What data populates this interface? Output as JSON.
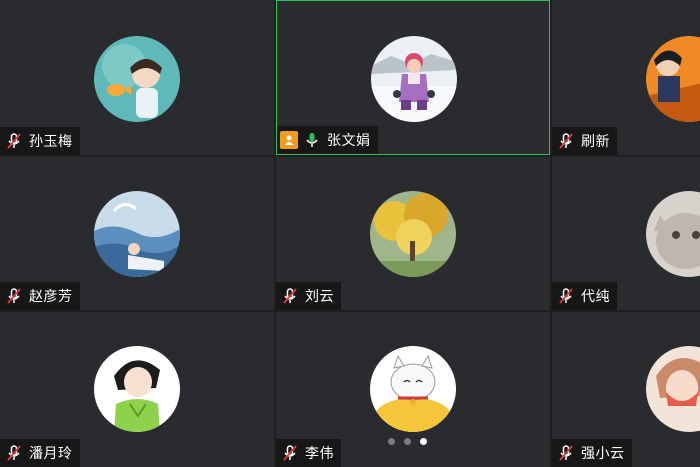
{
  "participants": [
    {
      "name": "孙玉梅",
      "mic": "muted",
      "avatar": "boy-fish-cartoon-avatar"
    },
    {
      "name": "张文娟",
      "mic": "on",
      "host": true,
      "active": true,
      "avatar": "child-snow-photo-avatar"
    },
    {
      "name": "刷新",
      "mic": "muted",
      "avatar": "anime-character-avatar"
    },
    {
      "name": "赵彦芳",
      "mic": "muted",
      "avatar": "sea-girl-illustration-avatar"
    },
    {
      "name": "刘云",
      "mic": "muted",
      "avatar": "ginkgo-tree-avatar"
    },
    {
      "name": "代纯",
      "mic": "muted",
      "avatar": "cat-photo-avatar"
    },
    {
      "name": "潘月玲",
      "mic": "muted",
      "avatar": "girl-green-dress-avatar"
    },
    {
      "name": "李伟",
      "mic": "muted",
      "avatar": "lucky-cat-avatar"
    },
    {
      "name": "强小云",
      "mic": "muted",
      "avatar": "girl-illustration-avatar"
    }
  ],
  "pager": {
    "pages": 3,
    "current": 3
  },
  "colors": {
    "active_border": "#2fbf5c",
    "host_badge": "#f39a1f",
    "mic_on": "#2fbf5c",
    "tile_bg": "#2a2b2e"
  }
}
